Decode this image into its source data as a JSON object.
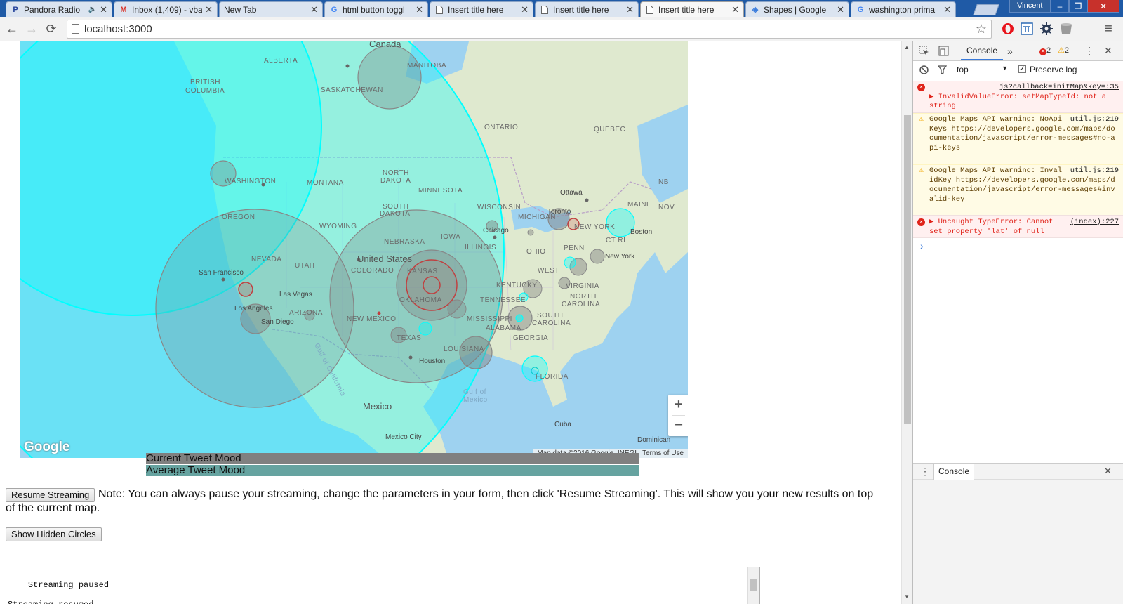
{
  "browser": {
    "tabs": [
      {
        "title": "Pandora Radio",
        "icon": "pandora-icon",
        "glyph": "P",
        "color": "#224099",
        "muted": true
      },
      {
        "title": "Inbox (1,409) - vba",
        "icon": "gmail-icon",
        "glyph": "M",
        "color": "#d93025"
      },
      {
        "title": "New Tab",
        "icon": "",
        "glyph": "",
        "color": "#333"
      },
      {
        "title": "html button toggl",
        "icon": "google-icon",
        "glyph": "G",
        "color": "#4285f4"
      },
      {
        "title": "Insert title here",
        "icon": "page-icon",
        "glyph": "",
        "color": "#555"
      },
      {
        "title": "Insert title here",
        "icon": "page-icon",
        "glyph": "",
        "color": "#555"
      },
      {
        "title": "Insert title here",
        "icon": "page-icon",
        "glyph": "",
        "color": "#555",
        "active": true
      },
      {
        "title": "Shapes | Google",
        "icon": "maps-dev-icon",
        "glyph": "◈",
        "color": "#3b7ddd"
      },
      {
        "title": "washington prima",
        "icon": "google-icon",
        "glyph": "G",
        "color": "#4285f4"
      }
    ],
    "tab_close_glyph": "✕",
    "mute_glyph": "🔈",
    "profile_name": "Vincent",
    "window_controls": {
      "minimize": "–",
      "restore": "❐",
      "close": "✕"
    },
    "url": "localhost:3000",
    "nav": {
      "back": "←",
      "forward": "→",
      "reload": "⟳",
      "star": "☆",
      "menu": "≡"
    },
    "extensions": [
      "opera-icon",
      "pi-icon",
      "gear-extension-icon",
      "cup-extension-icon"
    ]
  },
  "map": {
    "labels": {
      "canada": "Canada",
      "alberta": "ALBERTA",
      "british_columbia_1": "BRITISH",
      "british_columbia_2": "COLUMBIA",
      "manitoba": "MANITOBA",
      "saskatchewan": "SASKATCHEWAN",
      "ontario": "ONTARIO",
      "quebec": "QUEBEC",
      "washington": "WASHINGTON",
      "montana": "MONTANA",
      "north_dakota_1": "NORTH",
      "north_dakota_2": "DAKOTA",
      "minnesota": "MINNESOTA",
      "south_dakota_1": "SOUTH",
      "south_dakota_2": "DAKOTA",
      "wisconsin": "WISCONSIN",
      "michigan": "MICHIGAN",
      "ottawa": "Ottawa",
      "maine": "MAINE",
      "nb": "NB",
      "nov": "NOV",
      "toronto": "Toronto",
      "new_york_state": "NEW YORK",
      "boston": "Boston",
      "oregon": "OREGON",
      "wyoming": "WYOMING",
      "iowa": "IOWA",
      "nebraska": "NEBRASKA",
      "chicago": "Chicago",
      "illinois": "ILLINOIS",
      "ohio": "OHIO",
      "penn": "PENN",
      "ct_ri": "CT RI",
      "new_york_city": "New York",
      "nevada": "NEVADA",
      "utah": "UTAH",
      "united_states": "United States",
      "colorado": "COLORADO",
      "kansas": "KANSAS",
      "san_francisco": "San Francisco",
      "las_vegas": "Las Vegas",
      "west_virginia_1": "WEST",
      "virginia": "VIRGINIA",
      "kentucky": "KENTUCKY",
      "north_carolina_1": "NORTH",
      "north_carolina_2": "CAROLINA",
      "tennessee": "TENNESSEE",
      "oklahoma": "OKLAHOMA",
      "los_angeles": "Los Angeles",
      "arizona": "ARIZONA",
      "san_diego": "San Diego",
      "new_mexico": "NEW MEXICO",
      "mississippi": "MISSISSIPPI",
      "south_carolina_1": "SOUTH",
      "south_carolina_2": "CAROLINA",
      "alabama": "ALABAMA",
      "georgia": "GEORGIA",
      "texas": "TEXAS",
      "louisiana": "LOUISIANA",
      "houston": "Houston",
      "florida": "FLORIDA",
      "gulf_of_california": "Gulf of California",
      "gulf_of_mexico_1": "Gulf of",
      "gulf_of_mexico_2": "Mexico",
      "mexico": "Mexico",
      "cuba": "Cuba",
      "mexico_city": "Mexico City",
      "dominican": "Dominican"
    },
    "logo": "Google",
    "attribution": "Map data ©2016 Google, INEGI",
    "terms": "Terms of Use",
    "zoom_in": "+",
    "zoom_out": "−",
    "colors": {
      "ocean": "#9ed2f0",
      "land": "#dfe9cf",
      "cyan_circle": "#00ffff",
      "gray_circle": "#808080",
      "red_circle": "#d00000"
    }
  },
  "mood": {
    "current_label": "Current Tweet Mood",
    "average_label": "Average Tweet Mood",
    "current_color": "#808080",
    "average_color": "#66a3a0"
  },
  "controls": {
    "resume_button": "Resume Streaming",
    "note": "Note: You can always pause your streaming, change the parameters in your form, then click 'Resume Streaming'. This will show you your new results on top of the current map.",
    "show_hidden_button": "Show Hidden Circles"
  },
  "log": {
    "lines": "Streaming paused\n\nStreaming resumed"
  },
  "devtools": {
    "tab_console": "Console",
    "more_tabs": "»",
    "error_count": "2",
    "warning_count": "2",
    "context": "top",
    "preserve_log": "Preserve log",
    "messages": [
      {
        "level": "error",
        "source": "js?callback=initMap&key=:35",
        "text": "▶ InvalidValueError: setMapTypeId: not a string"
      },
      {
        "level": "warning",
        "source": "util.js:219",
        "text": "Google Maps API warning: NoApiKeys https://developers.google.com/maps/documentation/javascript/error-messages#no-api-keys"
      },
      {
        "level": "warning",
        "source": "util.js:219",
        "text": "Google Maps API warning: InvalidKey https://developers.google.com/maps/documentation/javascript/error-messages#invalid-key"
      },
      {
        "level": "error",
        "source": "(index):227",
        "text": "▶ Uncaught TypeError: Cannot set property 'lat' of null"
      }
    ],
    "prompt": "›",
    "drawer_title": "Console"
  }
}
